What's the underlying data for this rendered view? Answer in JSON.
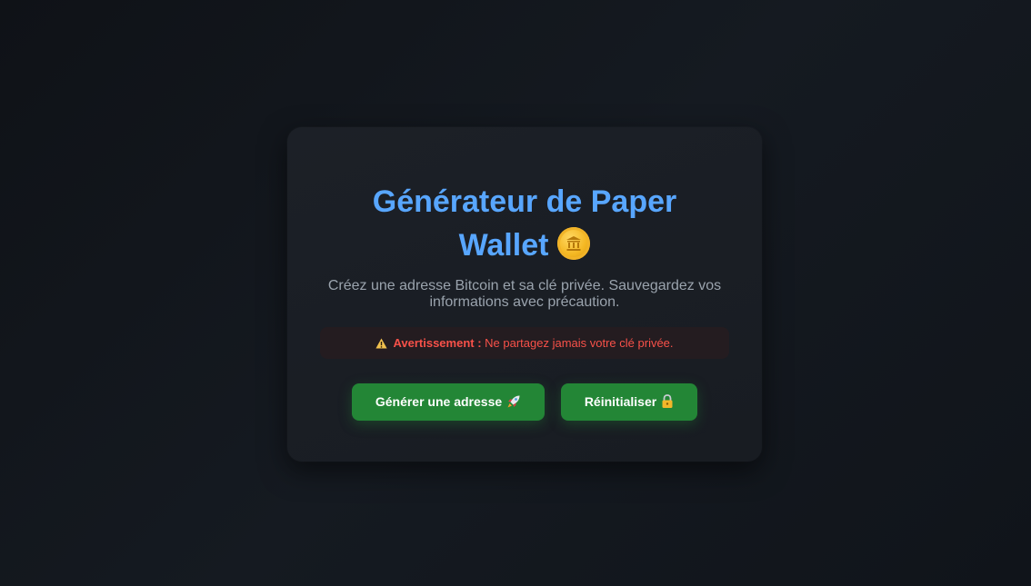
{
  "card": {
    "title": "Générateur de Paper Wallet",
    "title_icon": "coin-icon",
    "subtitle": "Créez une adresse Bitcoin et sa clé privée. Sauvegardez vos informations avec précaution.",
    "warning": {
      "icon": "warning-icon",
      "label": "Avertissement :",
      "text": "Ne partagez jamais votre clé privée."
    },
    "buttons": {
      "generate": {
        "label": "Générer une adresse",
        "icon": "rocket-icon"
      },
      "reset": {
        "label": "Réinitialiser",
        "icon": "lock-icon"
      }
    }
  },
  "colors": {
    "background": "#12161c",
    "card": "#1b1f26",
    "title": "#58a6ff",
    "subtitle": "#9aa3ad",
    "warning_text": "#f85149",
    "warning_bg": "#241c20",
    "button": "#238636"
  }
}
